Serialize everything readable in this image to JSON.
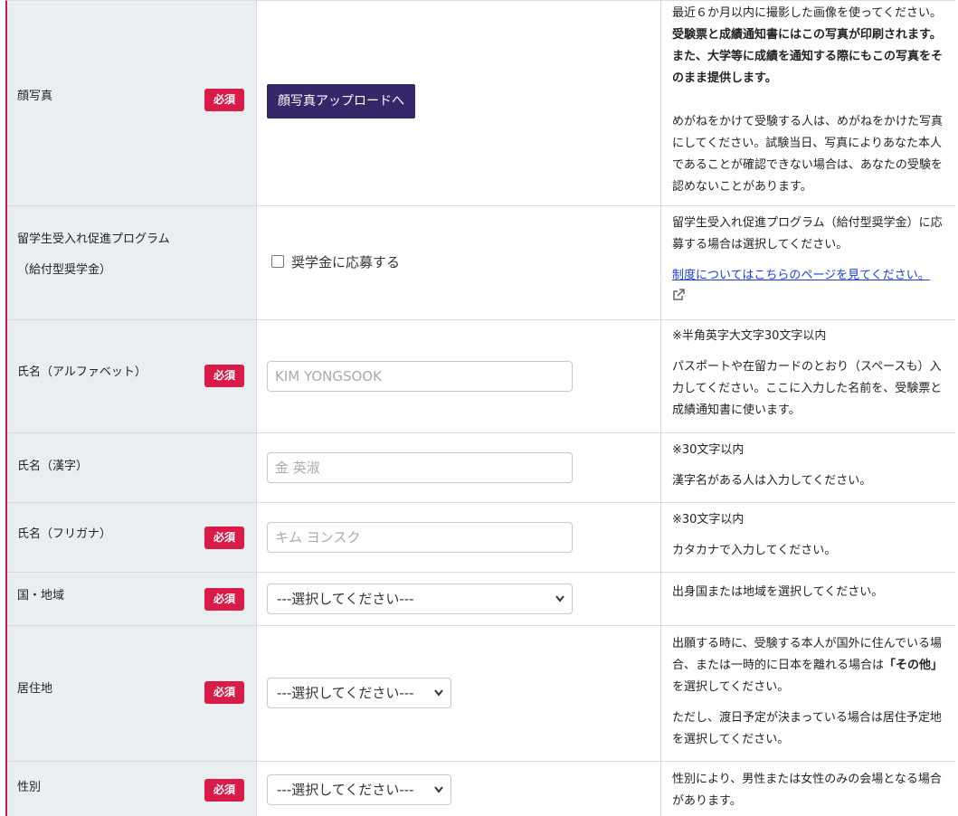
{
  "rows": {
    "photo": {
      "label": "顔写真",
      "required": "必須",
      "button": "顔写真アップロードへ",
      "note1_a": "最近６か月以内に撮影した画像を使ってください。",
      "note1_b": "受験票と成績通知書にはこの写真が印刷されます。また、大学等に成績を通知する際にもこの写真をそのまま提供します。",
      "note2": "めがねをかけて受験する人は、めがねをかけた写真にしてください。試験当日、写真によりあなた本人であることが確認できない場合は、あなたの受験を認めないことがあります。"
    },
    "scholarship": {
      "label_line1": "留学生受入れ促進プログラム",
      "label_line2": "（給付型奨学金）",
      "checkbox_label": "奨学金に応募する",
      "note": "留学生受入れ促進プログラム（給付型奨学金）に応募する場合は選択してください。",
      "link": "制度についてはこちらのページを見てください。"
    },
    "name_alpha": {
      "label": "氏名（アルファベット）",
      "required": "必須",
      "placeholder": "KIM YONGSOOK",
      "note1": "※半角英字大文字30文字以内",
      "note2": "パスポートや在留カードのとおり（スペースも）入力してください。ここに入力した名前を、受験票と成績通知書に使います。"
    },
    "name_kanji": {
      "label": "氏名（漢字）",
      "placeholder": "金 英淑",
      "note1": "※30文字以内",
      "note2": "漢字名がある人は入力してください。"
    },
    "name_kana": {
      "label": "氏名（フリガナ）",
      "required": "必須",
      "placeholder": "キム ヨンスク",
      "note1": "※30文字以内",
      "note2": "カタカナで入力してください。"
    },
    "country": {
      "label": "国・地域",
      "required": "必須",
      "select_value": "---選択してください---",
      "note": "出身国または地域を選択してください。"
    },
    "residence": {
      "label": "居住地",
      "required": "必須",
      "select_value": "---選択してください---",
      "note1_a": "出願する時に、受験する本人が国外に住んでいる場合、または一時的に日本を離れる場合は",
      "note1_b": "「その他」",
      "note1_c": "を選択してください。",
      "note2": "ただし、渡日予定が決まっている場合は居住予定地を選択してください。"
    },
    "gender": {
      "label": "性別",
      "required": "必須",
      "select_value": "---選択してください---",
      "note": "性別により、男性または女性のみの会場となる場合があります。"
    }
  },
  "colors": {
    "required_badge": "#d81b47",
    "upload_button": "#35276a",
    "label_bg": "#e9eef1",
    "left_border": "#c2185b",
    "link": "#1a3fd9"
  }
}
